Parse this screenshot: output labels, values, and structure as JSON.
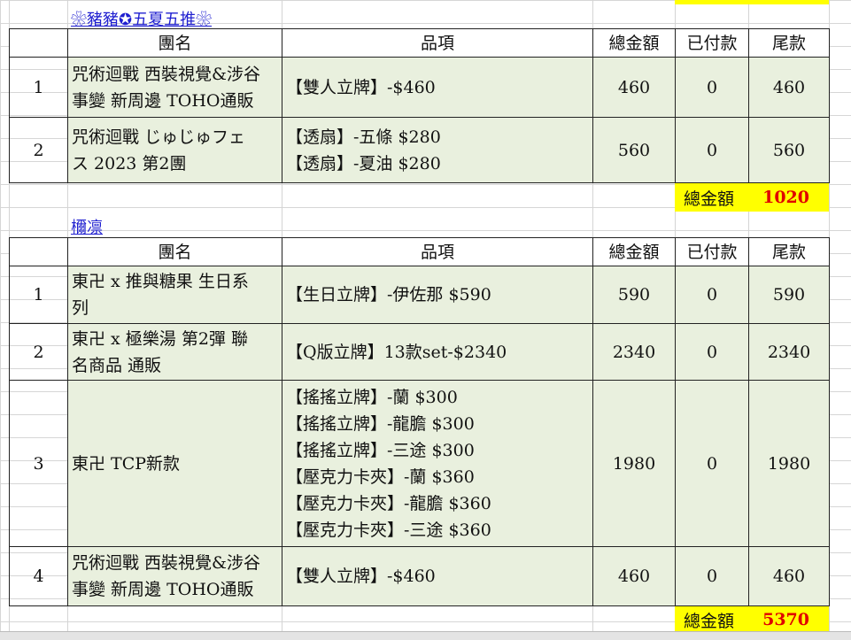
{
  "sheet": {
    "section1": {
      "title": "❀豬豬✪五夏五推❀",
      "headers": [
        "團名",
        "品項",
        "總金額",
        "已付款",
        "尾款"
      ],
      "rows": [
        {
          "no": "1",
          "group_lines": [
            "咒術迴戰 西裝視覺&涉谷",
            "事變 新周邊 TOHO通販"
          ],
          "items": [
            "【雙人立牌】-$460"
          ],
          "total": "460",
          "paid": "0",
          "balance": "460"
        },
        {
          "no": "2",
          "group_lines": [
            "咒術迴戰 じゅじゅフェ",
            "ス 2023 第2團"
          ],
          "items": [
            "【透扇】-五條  $280",
            "【透扇】-夏油  $280"
          ],
          "total": "560",
          "paid": "0",
          "balance": "560"
        }
      ],
      "grand_total_label": "總金額",
      "grand_total_value": "1020"
    },
    "section2": {
      "title": "檷凛",
      "headers": [
        "團名",
        "品項",
        "總金額",
        "已付款",
        "尾款"
      ],
      "rows": [
        {
          "no": "1",
          "group_lines": [
            "東卍 x 推與糖果 生日系",
            "列"
          ],
          "items": [
            "【生日立牌】-伊佐那  $590"
          ],
          "total": "590",
          "paid": "0",
          "balance": "590"
        },
        {
          "no": "2",
          "group_lines": [
            "東卍 x 極樂湯 第2彈 聯",
            "名商品 通販"
          ],
          "items": [
            "【Q版立牌】13款set-$2340"
          ],
          "total": "2340",
          "paid": "0",
          "balance": "2340"
        },
        {
          "no": "3",
          "group_lines": [
            "東卍 TCP新款"
          ],
          "items": [
            "【搖搖立牌】-蘭  $300",
            "【搖搖立牌】-龍膽  $300",
            "【搖搖立牌】-三途  $300",
            "【壓克力卡夾】-蘭  $360",
            "【壓克力卡夾】-龍膽  $360",
            "【壓克力卡夾】-三途  $360"
          ],
          "total": "1980",
          "paid": "0",
          "balance": "1980"
        },
        {
          "no": "4",
          "group_lines": [
            "咒術迴戰 西裝視覺&涉谷",
            "事變 新周邊 TOHO通販"
          ],
          "items": [
            "【雙人立牌】-$460"
          ],
          "total": "460",
          "paid": "0",
          "balance": "460"
        }
      ],
      "grand_total_label": "總金額",
      "grand_total_value": "5370"
    }
  },
  "colors": {
    "row_bg": "#e9f0de",
    "highlight": "#ffff00",
    "total_text": "#e00000",
    "link": "#1f1fd0"
  }
}
